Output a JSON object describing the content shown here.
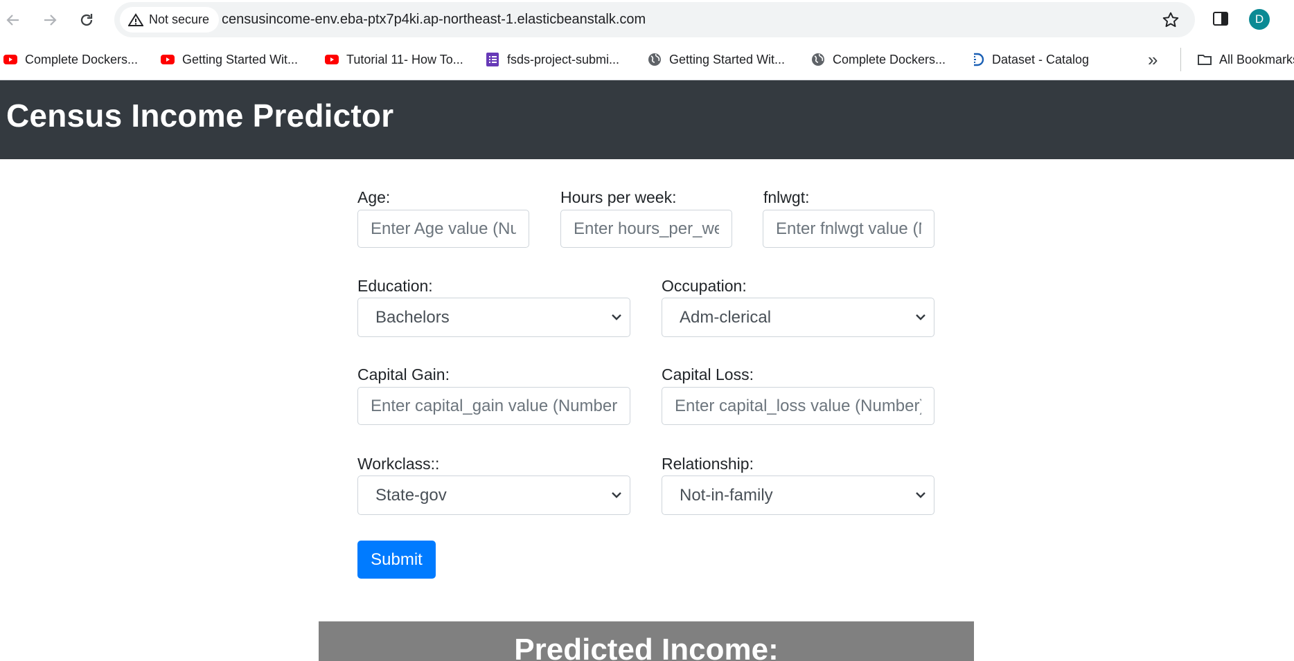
{
  "browser": {
    "security_label": "Not secure",
    "url": "censusincome-env.eba-ptx7p4ki.ap-northeast-1.elasticbeanstalk.com",
    "avatar_letter": "D",
    "bookmarks": [
      {
        "label": "Complete Dockers...",
        "icon": "youtube-icon"
      },
      {
        "label": "Getting Started Wit...",
        "icon": "youtube-icon"
      },
      {
        "label": "Tutorial 11- How To...",
        "icon": "youtube-icon"
      },
      {
        "label": "fsds-project-submi...",
        "icon": "forms-icon"
      },
      {
        "label": "Getting Started Wit...",
        "icon": "globe-icon"
      },
      {
        "label": "Complete Dockers...",
        "icon": "globe-icon"
      },
      {
        "label": "Dataset - Catalog",
        "icon": "catalog-icon"
      }
    ],
    "all_bookmarks_label": "All Bookmarks"
  },
  "page": {
    "title": "Census Income Predictor",
    "form": {
      "age": {
        "label": "Age:",
        "placeholder": "Enter Age value (Number)"
      },
      "hours": {
        "label": "Hours per week:",
        "placeholder": "Enter hours_per_week value (Number)"
      },
      "fnlwgt": {
        "label": "fnlwgt:",
        "placeholder": "Enter fnlwgt value (Number)"
      },
      "education": {
        "label": "Education:",
        "value": "Bachelors"
      },
      "occupation": {
        "label": "Occupation:",
        "value": "Adm-clerical"
      },
      "capital_gain": {
        "label": "Capital Gain:",
        "placeholder": "Enter capital_gain value (Number)"
      },
      "capital_loss": {
        "label": "Capital Loss:",
        "placeholder": "Enter capital_loss value (Number)"
      },
      "workclass": {
        "label": "Workclass::",
        "value": "State-gov"
      },
      "relationship": {
        "label": "Relationship:",
        "value": "Not-in-family"
      },
      "submit_label": "Submit"
    },
    "result_title": "Predicted Income:"
  },
  "colors": {
    "navbar": "#343a40",
    "primary": "#007bff",
    "result_panel": "#808080"
  }
}
